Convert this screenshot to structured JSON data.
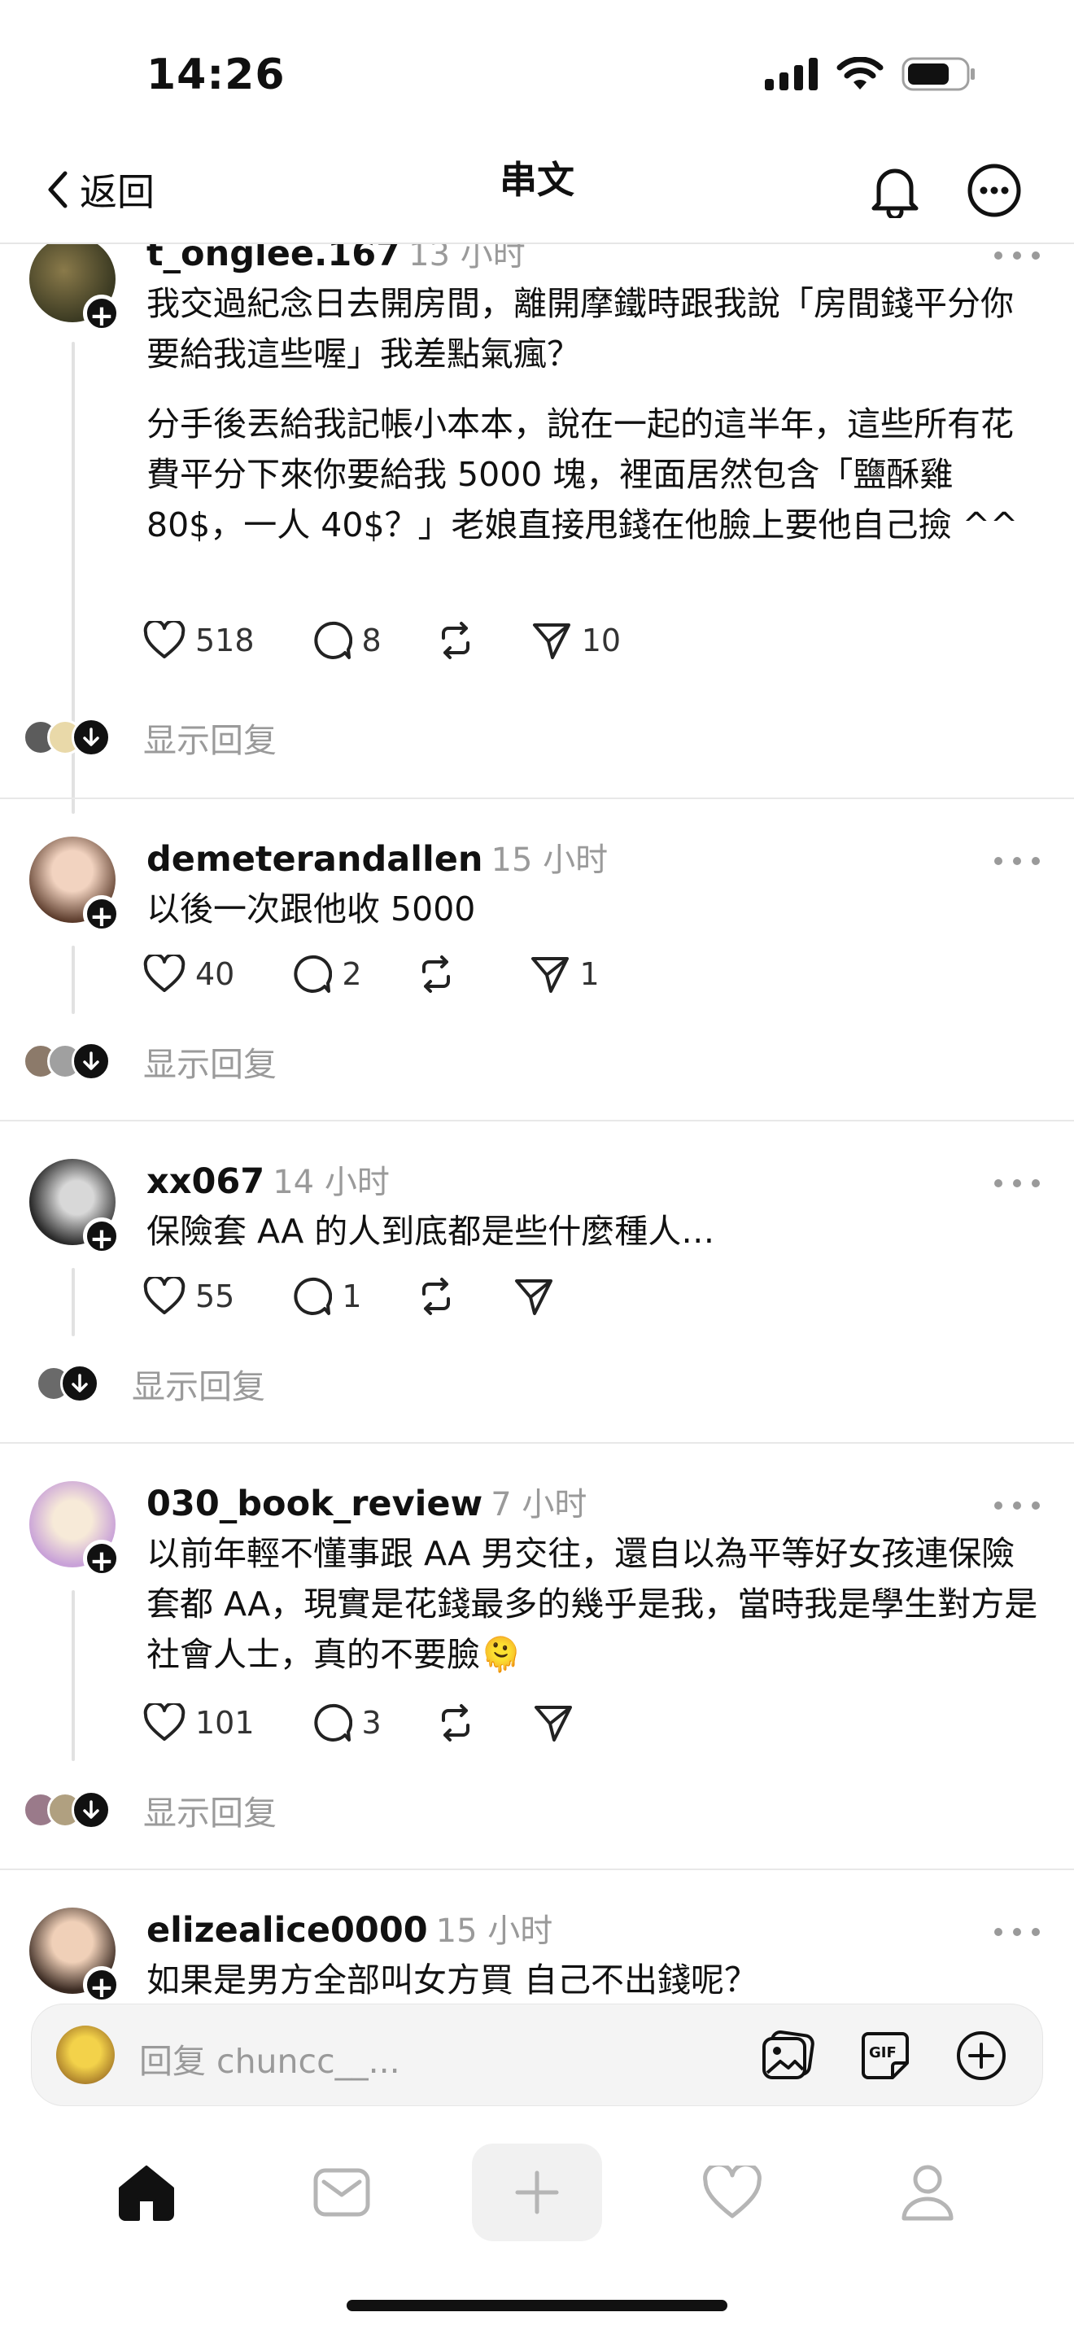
{
  "status_bar": {
    "time": "14:26"
  },
  "header": {
    "back_label": "返回",
    "title": "串文"
  },
  "posts": [
    {
      "username": "t_onglee.167",
      "time": "13 小时",
      "paragraphs": [
        "我交過紀念日去開房間，離開摩鐵時跟我說「房間錢平分你要給我這些喔」我差點氣瘋？",
        "分手後丟給我記帳小本本，說在一起的這半年，這些所有花費平分下來你要給我 5000 塊，裡面居然包含「鹽酥雞 80$，一人 40$？」老娘直接甩錢在他臉上要他自己撿 ^^"
      ],
      "likes": "518",
      "comments": "8",
      "shares": "10",
      "show_replies": "显示回复"
    },
    {
      "username": "demeterandallen",
      "time": "15 小时",
      "paragraphs": [
        "以後一次跟他收 5000"
      ],
      "likes": "40",
      "comments": "2",
      "shares": "1",
      "show_replies": "显示回复"
    },
    {
      "username": "xx067",
      "time": "14 小时",
      "paragraphs": [
        "保險套 AA 的人到底都是些什麼種人…"
      ],
      "likes": "55",
      "comments": "1",
      "shares": "",
      "show_replies": "显示回复"
    },
    {
      "username": "030_book_review",
      "time": "7 小时",
      "paragraphs": [
        "以前年輕不懂事跟 AA 男交往，還自以為平等好女孩連保險套都 AA，現實是花錢最多的幾乎是我，當時我是學生對方是社會人士，真的不要臉🫠"
      ],
      "likes": "101",
      "comments": "3",
      "shares": "",
      "show_replies": "显示回复"
    },
    {
      "username": "elizealice0000",
      "time": "15 小时",
      "paragraphs": [
        "如果是男方全部叫女方買 自己不出錢呢？"
      ],
      "likes": "",
      "comments": "",
      "shares": "",
      "show_replies": ""
    }
  ],
  "composer": {
    "placeholder": "回复 chuncc__..."
  },
  "tab_bar": {
    "items": [
      "home-icon",
      "mail-icon",
      "plus-icon",
      "heart-icon",
      "profile-icon"
    ]
  },
  "colors": {
    "text": "#101010",
    "muted": "#9a9a9a",
    "divider": "#e8e8e8"
  }
}
